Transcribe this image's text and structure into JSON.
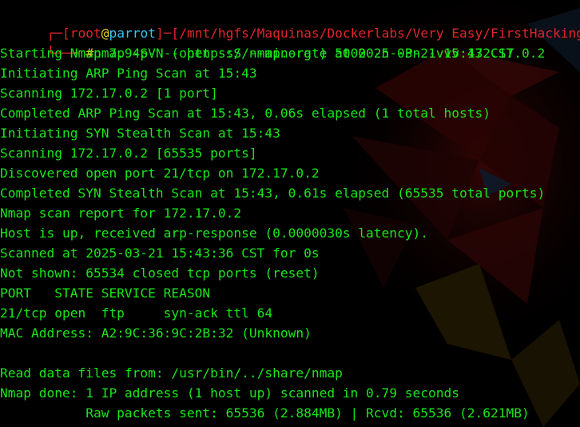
{
  "prompt": {
    "open_bracket": "┌─[",
    "user": "root",
    "at": "@",
    "host": "parrot",
    "sep": "]─[",
    "path": "/mnt/hgfs/Maquinas/Dockerlabs/Very Easy/FirstHacking",
    "close_bracket": "]",
    "lower": "└──╼ ",
    "hash": "#",
    "command": "nmap -p- --open -sS --min-rate 5000 -n -Pn -vvv 172.17.0.2"
  },
  "output": [
    "Starting Nmap 7.94SVN ( https://nmap.org ) at 2025-03-21 15:43 CST",
    "Initiating ARP Ping Scan at 15:43",
    "Scanning 172.17.0.2 [1 port]",
    "Completed ARP Ping Scan at 15:43, 0.06s elapsed (1 total hosts)",
    "Initiating SYN Stealth Scan at 15:43",
    "Scanning 172.17.0.2 [65535 ports]",
    "Discovered open port 21/tcp on 172.17.0.2",
    "Completed SYN Stealth Scan at 15:43, 0.61s elapsed (65535 total ports)",
    "Nmap scan report for 172.17.0.2",
    "Host is up, received arp-response (0.0000030s latency).",
    "Scanned at 2025-03-21 15:43:36 CST for 0s",
    "Not shown: 65534 closed tcp ports (reset)",
    "PORT   STATE SERVICE REASON",
    "21/tcp open  ftp     syn-ack ttl 64",
    "MAC Address: A2:9C:36:9C:2B:32 (Unknown)",
    "",
    "Read data files from: /usr/bin/../share/nmap",
    "Nmap done: 1 IP address (1 host up) scanned in 0.79 seconds",
    "           Raw packets sent: 65536 (2.884MB) | Rcvd: 65536 (2.621MB)"
  ],
  "colors": {
    "output": "#19e619",
    "bracket": "#e0262b",
    "user": "#e0262b",
    "host": "#37c3f0",
    "hash": "#f2d11c",
    "background": "#000000"
  },
  "background_icon": "parrot-os-wallpaper"
}
